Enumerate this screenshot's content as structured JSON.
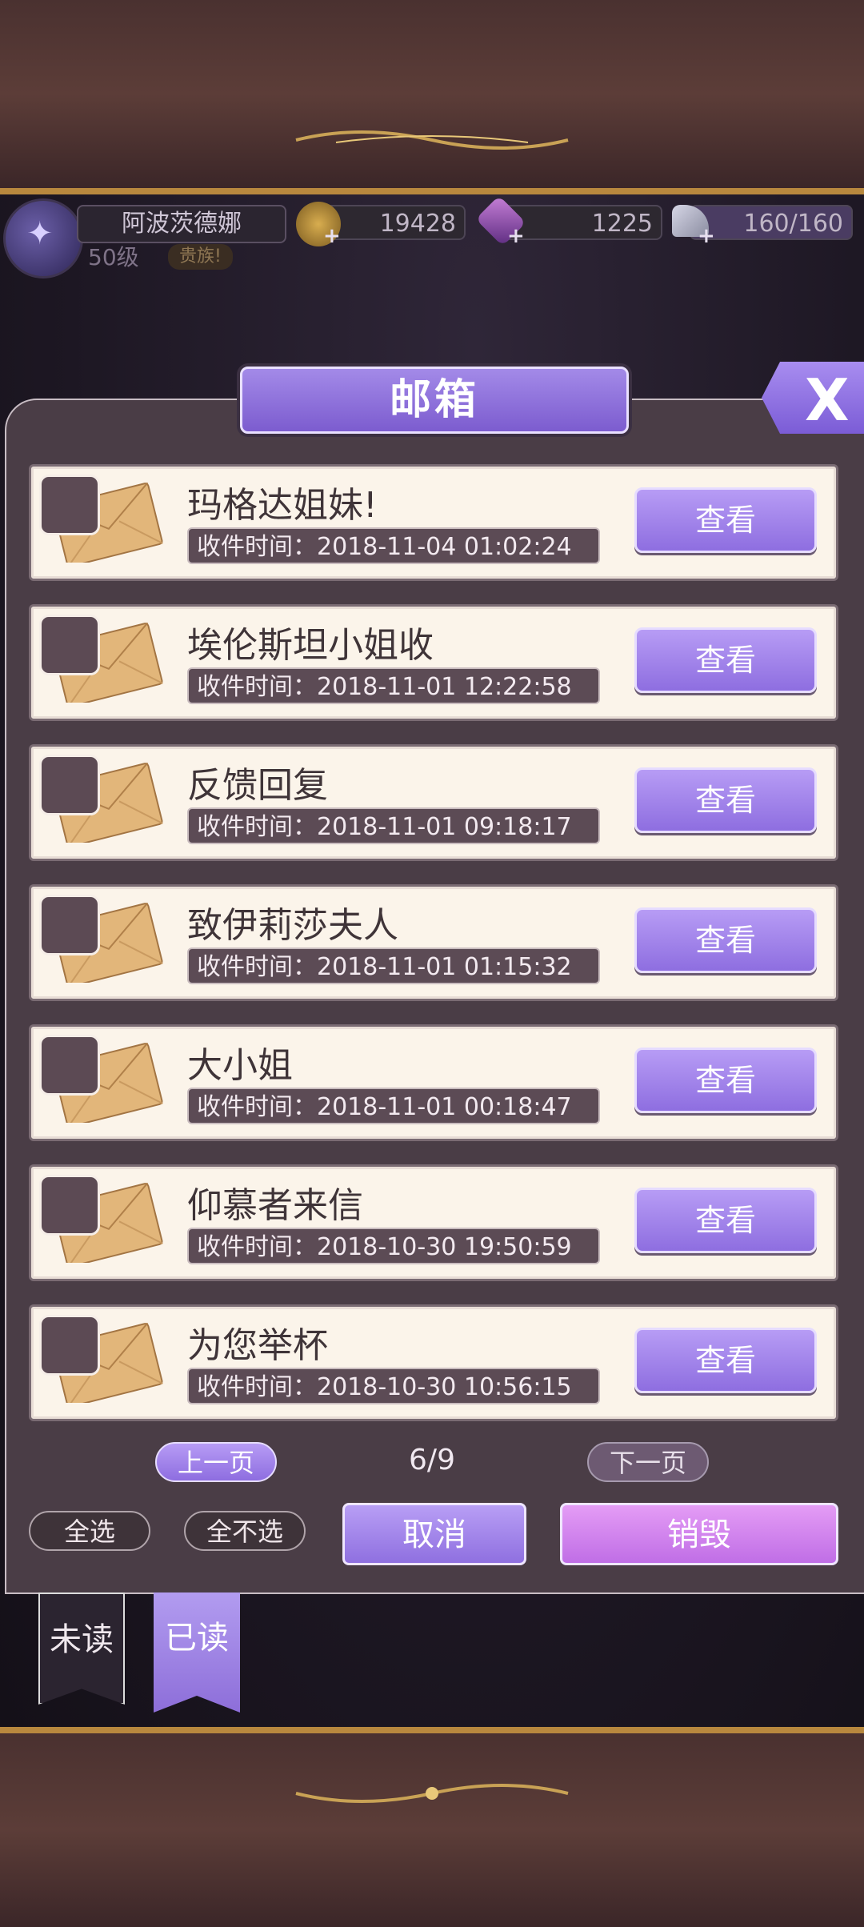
{
  "player": {
    "name": "阿波茨德娜",
    "level": "50级",
    "title_tag": "贵族!"
  },
  "resources": {
    "gold": "19428",
    "gems": "1225",
    "stamina": "160/160",
    "gold_icon": "crown-coin-icon",
    "gem_icon": "diamond-icon",
    "stamina_icon": "glass-slipper-icon"
  },
  "dialog": {
    "title": "邮箱",
    "close_icon": "close-icon",
    "close_glyph": "X"
  },
  "mails": [
    {
      "title": "玛格达姐妹!",
      "time": "收件时间：2018-11-04 01:02:24",
      "button": "查看"
    },
    {
      "title": "埃伦斯坦小姐收",
      "time": "收件时间：2018-11-01 12:22:58",
      "button": "查看"
    },
    {
      "title": "反馈回复",
      "time": "收件时间：2018-11-01 09:18:17",
      "button": "查看"
    },
    {
      "title": "致伊莉莎夫人",
      "time": "收件时间：2018-11-01 01:15:32",
      "button": "查看"
    },
    {
      "title": "大小姐",
      "time": "收件时间：2018-11-01 00:18:47",
      "button": "查看"
    },
    {
      "title": "仰慕者来信",
      "time": "收件时间：2018-10-30 19:50:59",
      "button": "查看"
    },
    {
      "title": "为您举杯",
      "time": "收件时间：2018-10-30 10:56:15",
      "button": "查看"
    }
  ],
  "pager": {
    "prev": "上一页",
    "next": "下一页",
    "page": "6/9"
  },
  "actions": {
    "select_all": "全选",
    "select_none": "全不选",
    "cancel": "取消",
    "destroy": "销毁"
  },
  "tabs": {
    "unread": "未读",
    "read": "已读"
  },
  "colors": {
    "accent_purple": "#8e6ee0",
    "destroy_pink": "#c06ee6",
    "row_bg": "#fbf4ea",
    "panel_bg": "#4a3d46"
  }
}
